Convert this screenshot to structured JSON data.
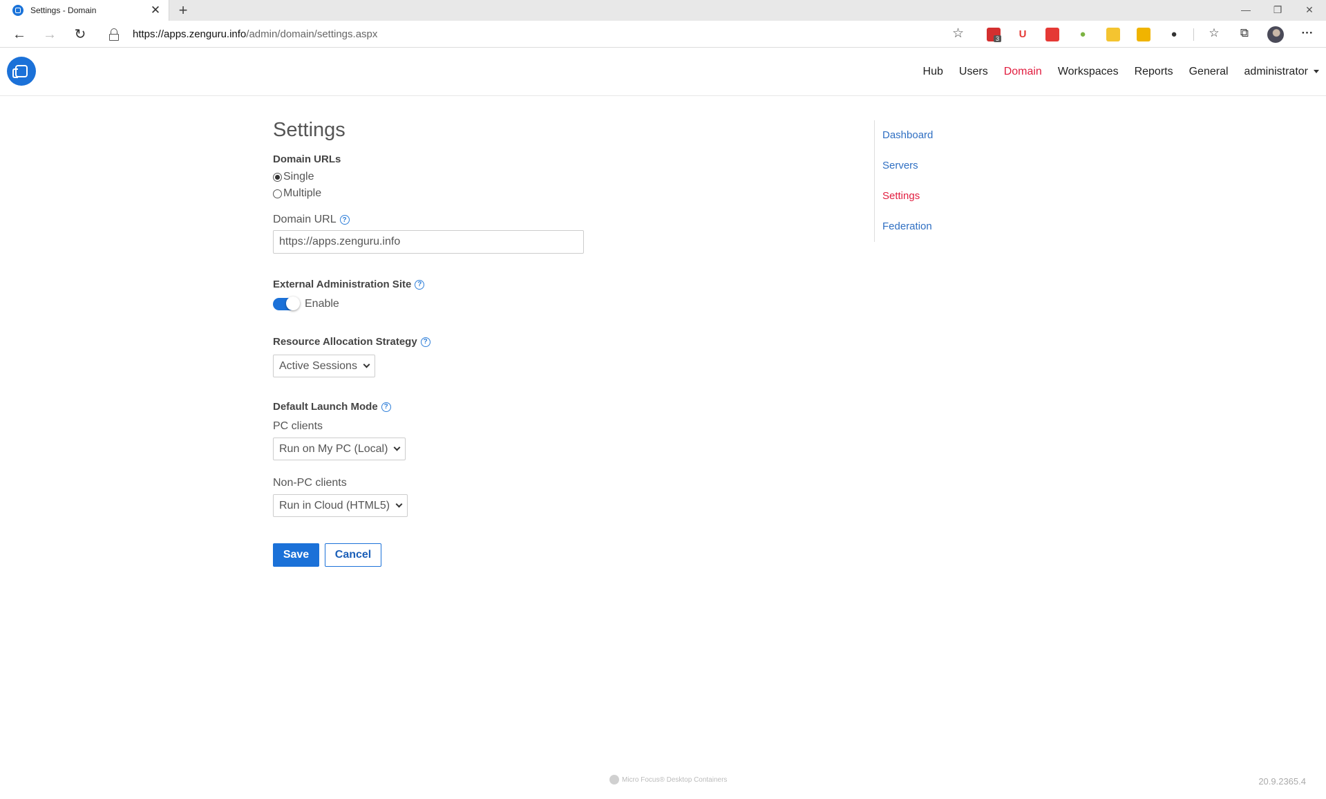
{
  "browser": {
    "tab_title": "Settings - Domain",
    "tab_close": "✕",
    "new_tab": "+",
    "url_host": "https://apps.zenguru.info",
    "url_path": "/admin/domain/settings.aspx",
    "extension_badge": "3",
    "win_minimize": "—",
    "win_restore": "❐",
    "win_close": "✕",
    "menu": "···"
  },
  "header": {
    "nav": [
      "Hub",
      "Users",
      "Domain",
      "Workspaces",
      "Reports",
      "General"
    ],
    "active_nav": "Domain",
    "user": "administrator"
  },
  "main": {
    "title": "Settings",
    "domain_urls": {
      "label": "Domain URLs",
      "options": [
        "Single",
        "Multiple"
      ],
      "selected": "Single"
    },
    "domain_url": {
      "label": "Domain URL",
      "value": "https://apps.zenguru.info"
    },
    "external_admin": {
      "label": "External Administration Site",
      "toggle_label": "Enable",
      "enabled": true
    },
    "resource_allocation": {
      "label": "Resource Allocation Strategy",
      "selected": "Active Sessions"
    },
    "default_launch": {
      "label": "Default Launch Mode",
      "pc_label": "PC clients",
      "pc_selected": "Run on My PC (Local)",
      "nonpc_label": "Non-PC clients",
      "nonpc_selected": "Run in Cloud (HTML5)"
    },
    "save_label": "Save",
    "cancel_label": "Cancel"
  },
  "sidenav": {
    "items": [
      "Dashboard",
      "Servers",
      "Settings",
      "Federation"
    ],
    "active": "Settings"
  },
  "footer": {
    "brand": "Micro Focus® Desktop Containers",
    "version": "20.9.2365.4"
  },
  "colors": {
    "accent": "#1b71d8",
    "active_nav": "#e11d3f",
    "link": "#2f6fc2"
  }
}
